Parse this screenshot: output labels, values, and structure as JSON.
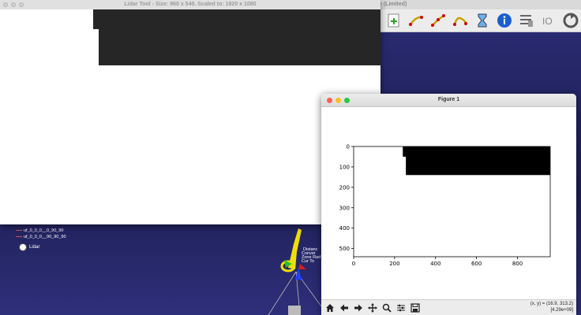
{
  "background_app": {
    "title": "e (Limited)",
    "toolbar_icons": [
      "add-page-icon",
      "path-icon",
      "path-node-icon",
      "path-edit-icon",
      "hourglass-icon",
      "info-icon",
      "list-settings-icon",
      "io-icon",
      "sync-icon"
    ],
    "tree": {
      "items": [
        "uf_0_0_0__0_90_90",
        "uf_0_0_0__90_90_90"
      ],
      "lidar_label": "Lidar"
    },
    "overlay_labels": [
      "Distanc",
      "Conver",
      "Zone Rad",
      "Cur To"
    ]
  },
  "lidar_window": {
    "title": "Lidar Tool - Size: 960 x 540. Scaled to: 1920 x 1080"
  },
  "figure_window": {
    "title": "Figure 1",
    "coords_line1": "(x, y) = (16.9, 313.2)",
    "coords_line2": "[4.29e+09]"
  },
  "colors": {
    "bg_gradient_top": "#2b2c75",
    "dark_region": "#262626",
    "mac_close": "#ff5f57",
    "mac_min": "#febc2e",
    "mac_max": "#28c840"
  },
  "chart_data": {
    "type": "heatmap",
    "x_ticks": [
      0,
      200,
      400,
      600,
      800
    ],
    "y_ticks": [
      0,
      100,
      200,
      300,
      400,
      500
    ],
    "xlim": [
      0,
      960
    ],
    "ylim": [
      540,
      0
    ],
    "black_region": {
      "x_start": 240,
      "notch_x_start": 255,
      "notch_y_end": 50,
      "x_end": 960,
      "y_end": 140
    }
  }
}
